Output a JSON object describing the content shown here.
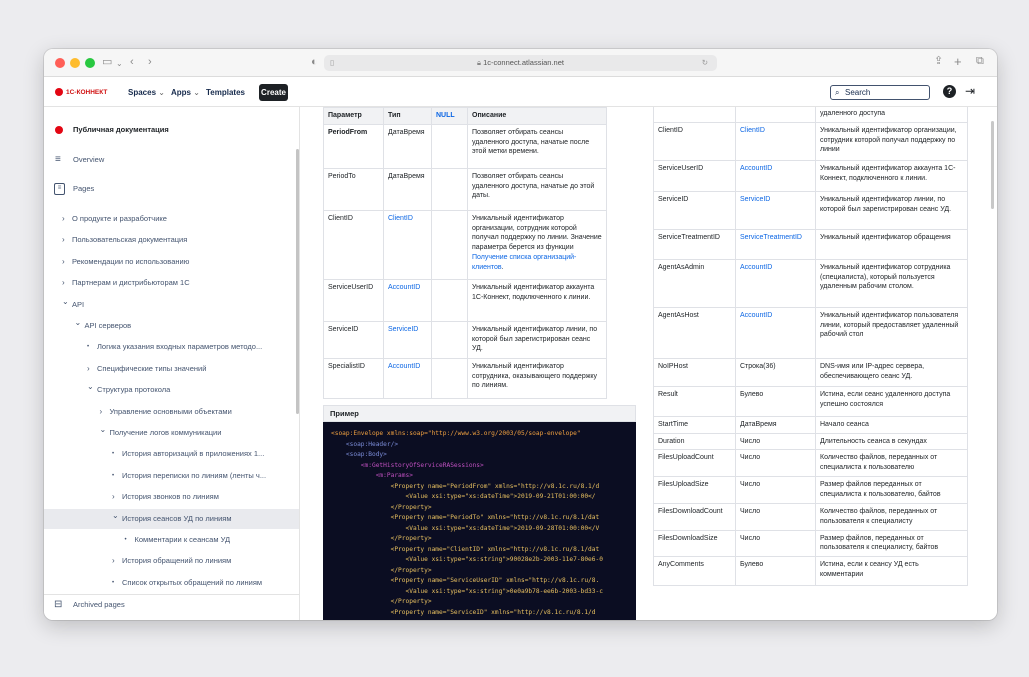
{
  "browser": {
    "url": "1c-connect.atlassian.net"
  },
  "app": {
    "logo": "1С-КОННЕКТ",
    "nav": [
      {
        "label": "Spaces"
      },
      {
        "label": "Apps"
      },
      {
        "label": "Templates"
      }
    ],
    "create": "Create",
    "search_placeholder": "Search"
  },
  "sidebar": {
    "space_title": "Публичная документация",
    "overview": "Overview",
    "pages": "Pages",
    "tree": [
      "О продукте и разработчике",
      "Пользовательская документация",
      "Рекомендации по использованию",
      "Партнерам и дистрибьюторам 1С",
      "API",
      "API серверов",
      "Логика указания входных параметров методо...",
      "Специфические типы значений",
      "Структура протокола",
      "Управление основными объектами",
      "Получение логов коммуникации",
      "История авторизаций в приложениях 1...",
      "История переписки по линиям (ленты ч...",
      "История звонков по линиям",
      "История сеансов УД по линиям",
      "Комментарии к сеансам УД",
      "История обращений по линиям",
      "Список открытых обращений по линиям"
    ],
    "archived": "Archived pages"
  },
  "left_table": {
    "headers": [
      "Параметр",
      "Тип",
      "NULL",
      "Описание"
    ],
    "rows": [
      {
        "param": "PeriodFrom",
        "type": "ДатаВремя",
        "null": "",
        "desc": "Позволяет отбирать сеансы удаленного доступа, начатые после этой метки времени."
      },
      {
        "param": "PeriodTo",
        "type": "ДатаВремя",
        "null": "",
        "desc": "Позволяет отбирать сеансы удаленного доступа, начатые до этой даты."
      },
      {
        "param": "ClientID",
        "type": "ClientID",
        "null": "",
        "desc": "Уникальный идентификатор организации, сотрудник которой получал поддержку по линии. Значение параметра берется из функции ",
        "desc_link": "Получение списка организаций-клиентов",
        "desc_end": "."
      },
      {
        "param": "ServiceUserID",
        "type": "AccountID",
        "null": "",
        "desc": "Уникальный идентификатор аккаунта 1С-Коннект, подключенного к линии."
      },
      {
        "param": "ServiceID",
        "type": "ServiceID",
        "null": "",
        "desc": "Уникальный идентификатор линии, по которой был зарегистрирован сеанс УД."
      },
      {
        "param": "SpecialistID",
        "type": "AccountID",
        "null": "",
        "desc": "Уникальный идентификатор сотрудника, оказывающего поддержку по линиям."
      }
    ]
  },
  "code": {
    "title": "Пример",
    "lines": [
      "<soap:Envelope xmlns:soap=\"http://www.w3.org/2003/05/soap-envelope\"",
      "    <soap:Header/>",
      "    <soap:Body>",
      "        <m:GetHistoryOfServiceRASessions>",
      "            <m:Params>",
      "                <Property name=\"PeriodFrom\" xmlns=\"http://v8.1c.ru/8.1/d",
      "                    <Value xsi:type=\"xs:dateTime\">2019-09-21T01:00:00</",
      "                </Property>",
      "                <Property name=\"PeriodTo\" xmlns=\"http://v8.1c.ru/8.1/dat",
      "                    <Value xsi:type=\"xs:dateTime\">2019-09-28T01:00:00</V",
      "                </Property>",
      "                <Property name=\"ClientID\" xmlns=\"http://v8.1c.ru/8.1/dat",
      "                    <Value xsi:type=\"xs:string\">90028e2b-2003-11e7-80e6-0",
      "                </Property>",
      "                <Property name=\"ServiceUserID\" xmlns=\"http://v8.1c.ru/8.",
      "                    <Value xsi:type=\"xs:string\">0e0a9b78-ee6b-2003-bd33-c",
      "                </Property>",
      "                <Property name=\"ServiceID\" xmlns=\"http://v8.1c.ru/8.1/d"
    ]
  },
  "right_table": {
    "top_desc": "удаленного доступа",
    "rows": [
      {
        "param": "ClientID",
        "type": "ClientID",
        "link": true,
        "desc": "Уникальный идентификатор организации, сотрудник которой получал поддержку по линии"
      },
      {
        "param": "ServiceUserID",
        "type": "AccountID",
        "link": true,
        "desc": "Уникальный идентификатор аккаунта 1С-Коннект, подключенного к линии."
      },
      {
        "param": "ServiceID",
        "type": "ServiceID",
        "link": true,
        "desc": "Уникальный идентификатор линии, по которой был зарегистрирован сеанс УД."
      },
      {
        "param": "ServiceTreatmentID",
        "type": "ServiceTreatmentID",
        "link": true,
        "desc": "Уникальный идентификатор обращения"
      },
      {
        "param": "AgentAsAdmin",
        "type": "AccountID",
        "link": true,
        "desc": "Уникальный идентификатор сотрудника (специалиста), который пользуется удаленным рабочим столом."
      },
      {
        "param": "AgentAsHost",
        "type": "AccountID",
        "link": true,
        "desc": "Уникальный идентификатор пользователя линии, который предоставляет удаленный рабочий стол"
      },
      {
        "param": "NoIPHost",
        "type": "Строка(36)",
        "link": false,
        "desc": "DNS-имя или IP-адрес сервера, обеспечивающего сеанс УД."
      },
      {
        "param": "Result",
        "type": "Булево",
        "link": false,
        "desc": "Истина, если сеанс удаленного доступа успешно состоялся"
      },
      {
        "param": "StartTime",
        "type": "ДатаВремя",
        "link": false,
        "desc": "Начало сеанса"
      },
      {
        "param": "Duration",
        "type": "Число",
        "link": false,
        "desc": "Длительность сеанса в секундах"
      },
      {
        "param": "FilesUploadCount",
        "type": "Число",
        "link": false,
        "desc": "Количество файлов, переданных от специалиста к пользователю"
      },
      {
        "param": "FilesUploadSize",
        "type": "Число",
        "link": false,
        "desc": "Размер файлов переданных от специалиста к пользователю, байтов"
      },
      {
        "param": "FilesDownloadCount",
        "type": "Число",
        "link": false,
        "desc": "Количество файлов, переданных от пользователя к специалисту"
      },
      {
        "param": "FilesDownloadSize",
        "type": "Число",
        "link": false,
        "desc": "Размер файлов, переданных от пользователя к специалисту, байтов"
      },
      {
        "param": "AnyComments",
        "type": "Булево",
        "link": false,
        "desc": "Истина, если к сеансу УД есть комментарии"
      }
    ]
  }
}
